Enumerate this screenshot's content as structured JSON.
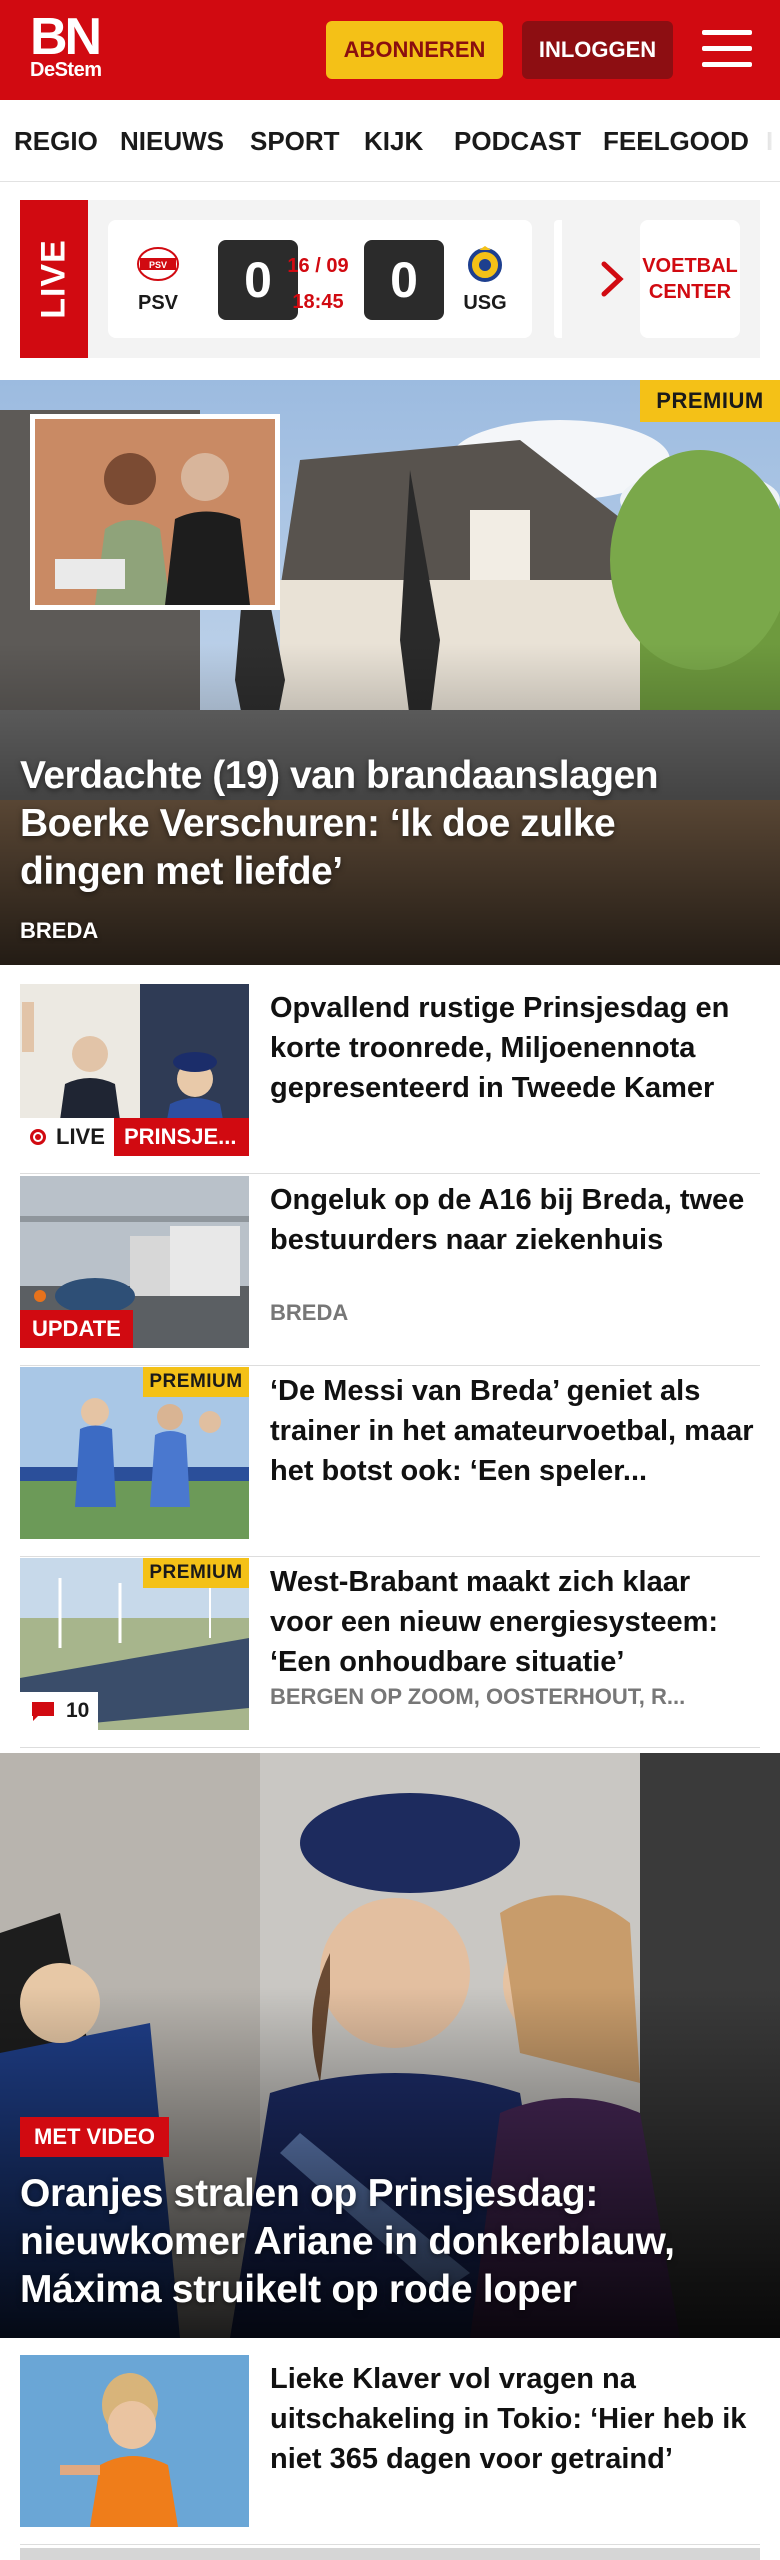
{
  "header": {
    "logo_main": "BN",
    "logo_sub": "DeStem",
    "subscribe_label": "ABONNEREN",
    "login_label": "INLOGGEN",
    "brand_color": "#d10a11"
  },
  "nav": {
    "items": [
      "REGIO",
      "NIEUWS",
      "SPORT",
      "KIJK",
      "PODCAST",
      "FEELGOOD"
    ]
  },
  "live": {
    "label": "LIVE",
    "match": {
      "home": "PSV",
      "away": "USG",
      "home_score": "0",
      "away_score": "0",
      "date": "16 / 09",
      "time": "18:45"
    },
    "football_center": "VOETBAL CENTER"
  },
  "hero": {
    "badge": "PREMIUM",
    "title": "Verdachte (19) van brandaanslagen Boerke Verschuren: ‘Ik doe zulke dingen met liefde’",
    "location": "BREDA"
  },
  "articles": [
    {
      "title": "Opvallend rustige Prinsjesdag en korte troonrede, Miljoenennota gepresenteerd in Tweede Kamer",
      "live_label": "LIVE",
      "tag": "PRINSJE..."
    },
    {
      "title": "Ongeluk op de A16 bij Breda, twee bestuurders naar ziekenhuis",
      "tag": "UPDATE",
      "location": "BREDA"
    },
    {
      "title": "‘De Messi van Breda’ geniet als trainer in het amateurvoetbal, maar het botst ook: ‘Een speler...",
      "badge": "PREMIUM"
    },
    {
      "title": "West-Brabant maakt zich klaar voor een nieuw energiesysteem: ‘Een onhoudbare situatie’",
      "badge": "PREMIUM",
      "comments": "10",
      "location": "BERGEN OP ZOOM, OOSTERHOUT, R..."
    }
  ],
  "hero2": {
    "tag": "MET VIDEO",
    "title": "Oranjes stralen op Prinsjesdag: nieuwkomer Ariane in donkerblauw, Máxima struikelt op rode loper"
  },
  "article_last": {
    "title": "Lieke Klaver vol vragen na uitschakeling in Tokio: ‘Hier heb ik niet 365 dagen voor getraind’"
  }
}
